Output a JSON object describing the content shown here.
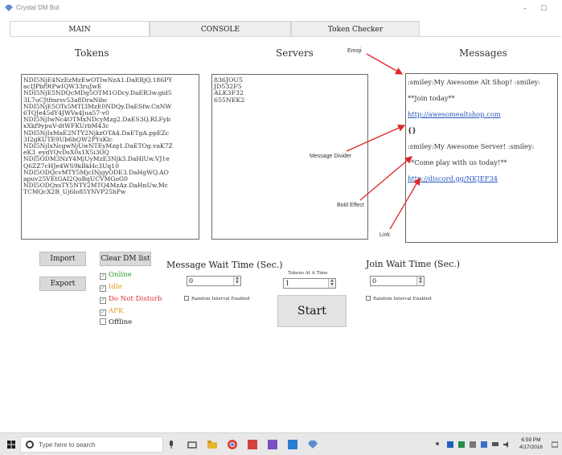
{
  "window": {
    "title": "Crystal DM Bot",
    "controls": {
      "minimize": "–",
      "maximize": "☐"
    }
  },
  "tabs": [
    {
      "label": "MAIN",
      "active": true
    },
    {
      "label": "CONSOLE",
      "active": false
    },
    {
      "label": "Token Checker",
      "active": false
    }
  ],
  "headings": {
    "tokens": "Tokens",
    "servers": "Servers",
    "messages": "Messages"
  },
  "tokens_list": [
    "NDI5NjE4NzEzMzEwOTIwNzA1.DaERjQ.186PY",
    "acIJPbf9tPwIQW33ruJwE",
    "NDI5NjE5NDQcMDg5OTM1ODcy.DaER3w.gid5",
    "3L7uCJtfmrsv53a8DraNibc",
    "NDI5NjE5OTs5MTI3MzE0NDQy.DaESfw.CnNW",
    "6TQJe45dY4JWVa4Jua57-v0",
    "NDI5NjIwNc4OTMxNDcyMzg2.DaES3Q.RLFyb",
    "xXkf9ypuV-dtWFKUrbM43c",
    "NDI5NjIxMaE2NTY2NjkzOTA4.DaETgA.ppEZc",
    "3I2gKUTE9Ub6bQW2PYsKlc",
    "NDI5NjIxNcgwNjUwNTEyMzg1.DaETOg.vaK7Z",
    "eK3_eydYQvDsX0s1X5i3OQ",
    "NDI5ODM3NzY4MjUyMzE3Njk3.DaHlUw.VJ1e",
    "Q6ZZ7cHJe4WS9kBkHc3Uq10",
    "NDI5ODQcvMTY5MjcINjgyODE3.DaHgWQ.AO",
    "apuv25VEtGAI2QoBqUCVMGoG0",
    "NDI5ODQxsTY5NTY2MTQ4MzAz.DaHnUw.Mc",
    "TCMQcX2B_Uj6lo85YNVP25hPw"
  ],
  "servers_list": [
    "836JOU5",
    "JD532F5",
    "ALK3F32",
    "655NEK2"
  ],
  "messages": {
    "lines": [
      ":smiley:My Awesome Alt Shop! :smiley:",
      "**Join today**",
      "http://awesomealtshop.com",
      "{}",
      ":smiley:My Awesome Server! :smiley:",
      "**Come play with us today!**",
      "http://discord.gg/NKJEF34"
    ]
  },
  "annotations": {
    "emoji": "Emoji",
    "message_divider": "Message Divider",
    "bold_effect": "Bold Effect",
    "link": "Link"
  },
  "buttons": {
    "import": "Import",
    "export": "Export",
    "clear_dm_list": "Clear DM list",
    "start": "Start"
  },
  "status_filters": [
    {
      "label": "Online",
      "checked": true,
      "color": "#2e9a2e"
    },
    {
      "label": "Idle",
      "checked": true,
      "color": "#e39a1c"
    },
    {
      "label": "Do Not Disturb",
      "checked": true,
      "color": "#d8322c"
    },
    {
      "label": "AFK",
      "checked": true,
      "color": "#e39a1c"
    },
    {
      "label": "Offline",
      "checked": false,
      "color": "#222222"
    }
  ],
  "message_wait": {
    "label": "Message Wait Time (Sec.)",
    "value": "0",
    "random_label": "Random Interval Enabled",
    "random_checked": false
  },
  "tokens_at_a_time": {
    "label": "Tokens At A Time",
    "value": "1"
  },
  "join_wait": {
    "label": "Join Wait Time (Sec.)",
    "value": "0",
    "random_label": "Random Interval Enabled",
    "random_checked": false
  },
  "taskbar": {
    "search_placeholder": "Type here to search",
    "time": "6:59 PM",
    "date": "4/17/2018"
  },
  "colors": {
    "link": "#2a58c0",
    "arrow": "#e0262a",
    "check": "#2a7a2a"
  }
}
